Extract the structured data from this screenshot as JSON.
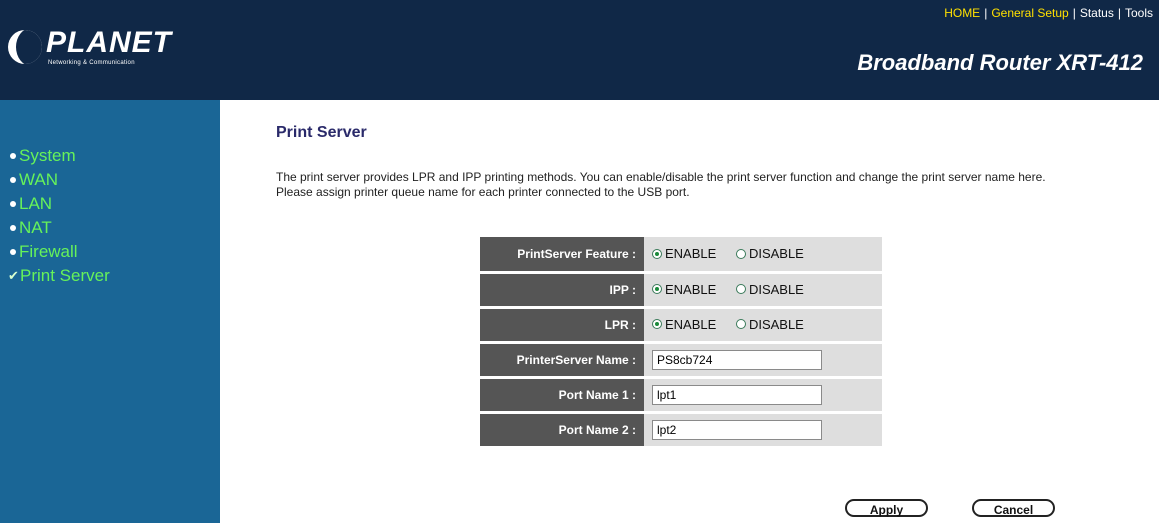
{
  "header": {
    "logo_text": "PLANET",
    "logo_tagline": "Networking & Communication",
    "product": "Broadband Router XRT-412",
    "nav": [
      {
        "label": "HOME"
      },
      {
        "label": "General Setup"
      },
      {
        "label": "Status"
      },
      {
        "label": "Tools"
      }
    ],
    "nav_separator": "|"
  },
  "sidebar": {
    "items": [
      {
        "label": "System"
      },
      {
        "label": "WAN"
      },
      {
        "label": "LAN"
      },
      {
        "label": "NAT"
      },
      {
        "label": "Firewall"
      },
      {
        "label": "Print Server",
        "active": true
      }
    ]
  },
  "main": {
    "title": "Print Server",
    "description": "The print server provides LPR and IPP printing methods. You can enable/disable the print server function and change the print server name here. Please assign printer queue name for each printer connected to the USB port.",
    "fields": {
      "feature": {
        "label": "PrintServer Feature :",
        "enable": "ENABLE",
        "disable": "DISABLE",
        "selected": "ENABLE"
      },
      "ipp": {
        "label": "IPP :",
        "enable": "ENABLE",
        "disable": "DISABLE",
        "selected": "ENABLE"
      },
      "lpr": {
        "label": "LPR :",
        "enable": "ENABLE",
        "disable": "DISABLE",
        "selected": "ENABLE"
      },
      "server_name": {
        "label": "PrinterServer Name :",
        "value": "PS8cb724"
      },
      "port1": {
        "label": "Port Name 1 :",
        "value": "lpt1"
      },
      "port2": {
        "label": "Port Name 2 :",
        "value": "lpt2"
      }
    },
    "buttons": {
      "apply": "Apply",
      "cancel": "Cancel"
    }
  },
  "colors": {
    "header_bg": "#102847",
    "sidebar_bg": "#1a6696",
    "sidebar_text": "#66f25a",
    "nav_highlight": "#ffe000",
    "label_bg": "#555555",
    "value_bg": "#dedede"
  }
}
